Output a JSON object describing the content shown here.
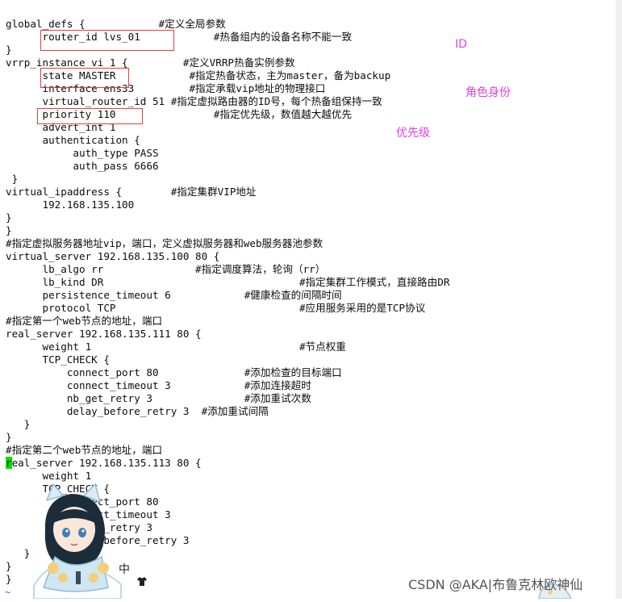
{
  "terminal": {
    "lines": [
      "global_defs {            #定义全局参数",
      "      router_id lvs_01            #热备组内的设备名称不能一致",
      "}",
      "vrrp_instance vi_1 {         #定义VRRP热备实例参数",
      "      state MASTER            #指定热备状态，主为master，备为backup",
      "      interface ens33         #指定承载vip地址的物理接口",
      "      virtual_router_id 51 #指定虚拟路由器的ID号，每个热备组保持一致",
      "      priority 110                #指定优先级，数值越大越优先",
      "      advert_int 1",
      "      authentication {",
      "           auth_type PASS",
      "           auth_pass 6666",
      " }",
      "virtual_ipaddress {        #指定集群VIP地址",
      "      192.168.135.100",
      "}",
      "}",
      "#指定虚拟服务器地址vip，端口，定义虚拟服务器和web服务器池参数",
      "virtual_server 192.168.135.100 80 {",
      "      lb_algo rr               #指定调度算法，轮询（rr）",
      "      lb_kind DR                                #指定集群工作模式，直接路由DR",
      "      persistence_timeout 6            #健康检查的间隔时间",
      "      protocol TCP                              #应用服务采用的是TCP协议",
      "#指定第一个web节点的地址，端口",
      "real_server 192.168.135.111 80 {",
      "      weight 1                                  #节点权重",
      "      TCP_CHECK {",
      "          connect_port 80              #添加检查的目标端口",
      "          connect_timeout 3            #添加连接超时",
      "          nb_get_retry 3               #添加重试次数",
      "          delay_before_retry 3  #添加重试间隔",
      "   }",
      "}",
      "#指定第二个web节点的地址，端口",
      "real_server 192.168.135.113 80 {",
      "      weight 1",
      "      TCP_CHECK {",
      "          connect_port 80",
      "          connect_timeout 3",
      "          nb_get_retry 3",
      "          delay_before_retry 3",
      "   }",
      "}",
      "}"
    ],
    "cursor_line_rest": "eal_server 192.168.135.113 80 {",
    "cursor_char": "r",
    "tilde": "~"
  },
  "annotations": {
    "id_label": "ID",
    "role_label": "角色身份",
    "priority_label": "优先级",
    "color": "#e040e0",
    "box_color": "#e0403a"
  },
  "watermark": {
    "text": "CSDN @AKA|布鲁克林欧神仙"
  },
  "avatar": {
    "badge_text": "中"
  }
}
